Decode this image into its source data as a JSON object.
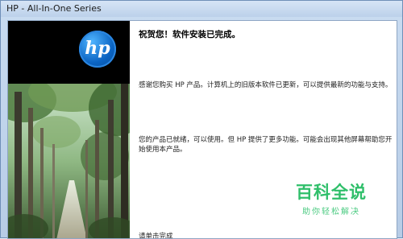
{
  "window": {
    "title": "HP - All-In-One Series"
  },
  "sidebar": {
    "logo_text": "hp"
  },
  "main": {
    "heading": "祝贺您！软件安装已完成。",
    "paragraph1": "感谢您购买 HP 产品。计算机上的旧版本软件已更新，可以提供最新的功能与支持。",
    "paragraph2": "您的产品已就绪，可以使用。但 HP 提供了更多功能。可能会出现其他屏幕帮助您开始使用本产品。",
    "paragraph3": "请单击完成"
  },
  "watermark": {
    "main": "百科全说",
    "sub": "助你轻松解决"
  },
  "colors": {
    "title_bg": "#c9dcf1",
    "hp_blue": "#0a63c2",
    "watermark_green": "#2fbf6a"
  }
}
